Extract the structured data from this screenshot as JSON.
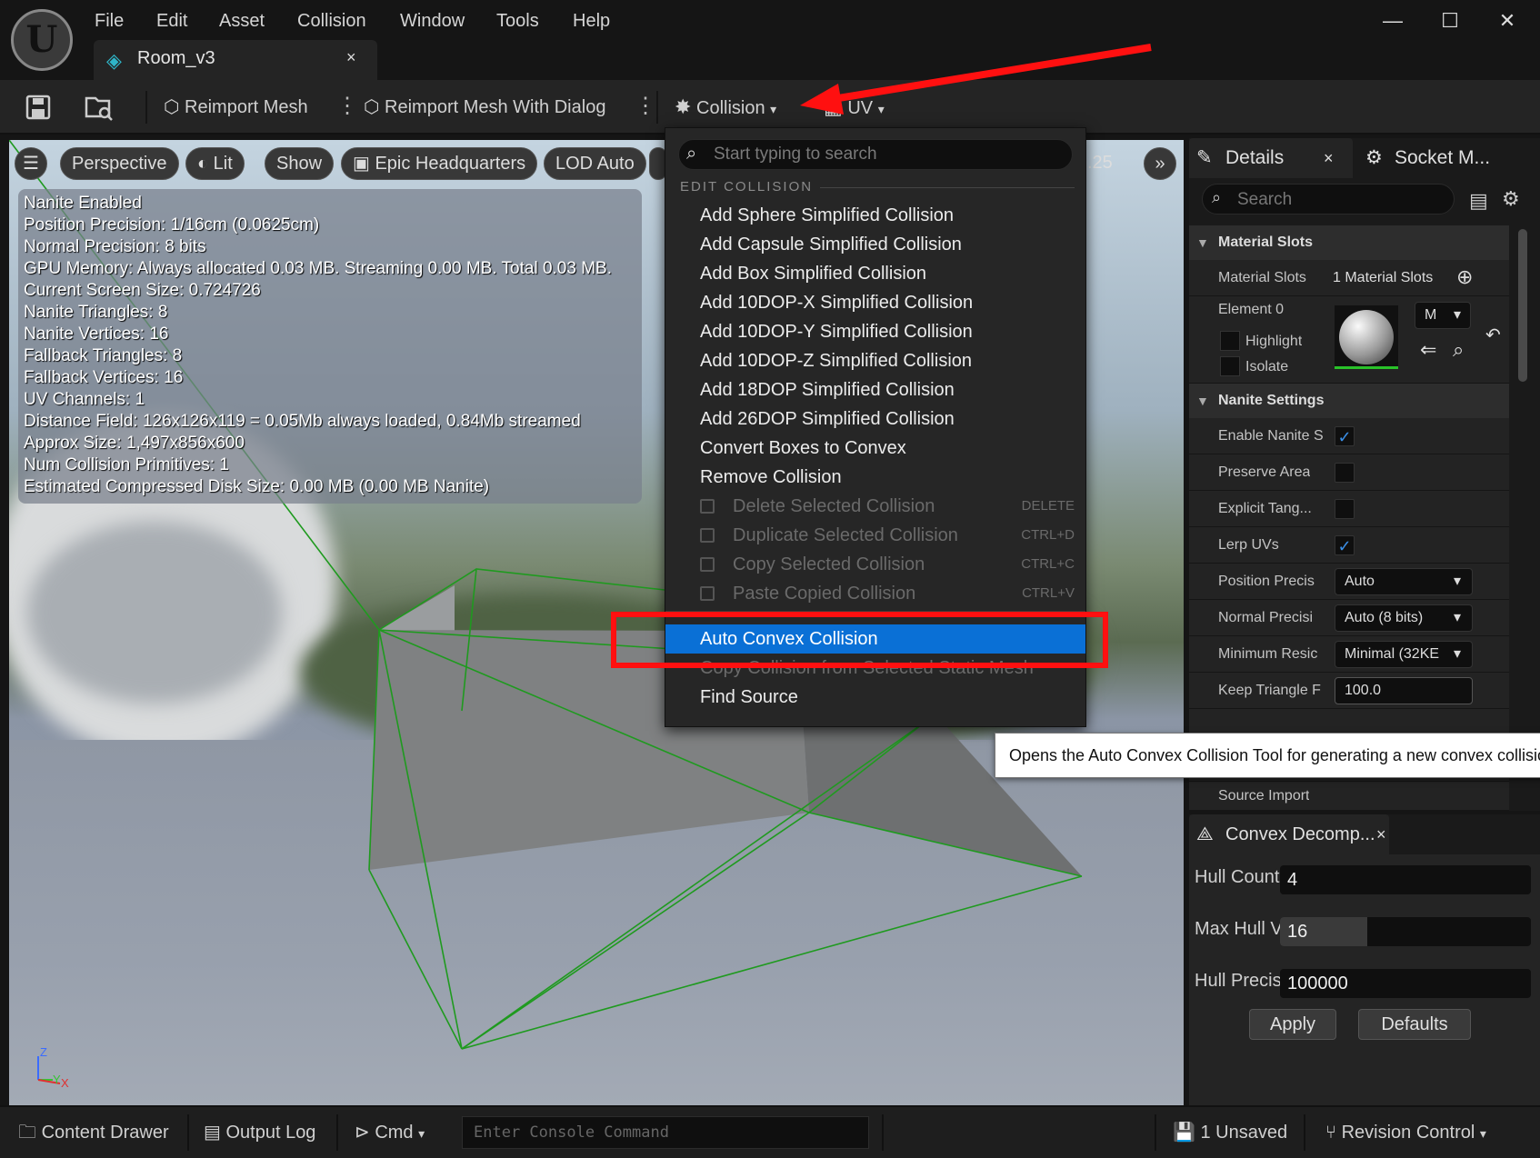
{
  "menubar": {
    "items": [
      "File",
      "Edit",
      "Asset",
      "Collision",
      "Window",
      "Tools",
      "Help"
    ]
  },
  "window_controls": {
    "minimize": "—",
    "maximize": "☐",
    "close": "✕"
  },
  "document_tab": {
    "label": "Room_v3",
    "close": "×"
  },
  "toolbar": {
    "reimport_mesh": "Reimport Mesh",
    "reimport_mesh_dialog": "Reimport Mesh With Dialog",
    "collision": "Collision",
    "uv": "UV"
  },
  "viewport": {
    "toolbar": {
      "perspective": "Perspective",
      "lit": "Lit",
      "show": "Show",
      "headquarters": "Epic Headquarters",
      "lod": "LOD Auto",
      "speed": ".25"
    },
    "info_lines": [
      "Nanite Enabled",
      "Position Precision: 1/16cm (0.0625cm)",
      "Normal Precision: 8 bits",
      "GPU Memory: Always allocated 0.03 MB. Streaming 0.00 MB. Total 0.03 MB.",
      "Current Screen Size:  0.724726",
      "Nanite Triangles:  8",
      "Nanite Vertices:  16",
      "Fallback Triangles:  8",
      "Fallback Vertices:  16",
      "UV Channels:  1",
      "Distance Field:  126x126x119 = 0.05Mb always loaded, 0.84Mb streamed",
      "Approx Size: 1,497x856x600",
      "Num Collision Primitives:  1",
      "Estimated Compressed Disk Size: 0.00 MB (0.00 MB Nanite)"
    ],
    "axis": {
      "z": "Z",
      "y": "Y",
      "x": "X"
    },
    "colors": {
      "wireframe": "#1f9a1f"
    }
  },
  "collision_menu": {
    "search_placeholder": "Start typing to search",
    "section": "EDIT COLLISION",
    "items": [
      {
        "label": "Add Sphere Simplified Collision"
      },
      {
        "label": "Add Capsule Simplified Collision"
      },
      {
        "label": "Add Box Simplified Collision"
      },
      {
        "label": "Add 10DOP-X Simplified Collision"
      },
      {
        "label": "Add 10DOP-Y Simplified Collision"
      },
      {
        "label": "Add 10DOP-Z Simplified Collision"
      },
      {
        "label": "Add 18DOP Simplified Collision"
      },
      {
        "label": "Add 26DOP Simplified Collision"
      },
      {
        "label": "Convert Boxes to Convex"
      },
      {
        "label": "Remove Collision"
      }
    ],
    "disabled_items": [
      {
        "label": "Delete Selected Collision",
        "shortcut": "DELETE"
      },
      {
        "label": "Duplicate Selected Collision",
        "shortcut": "CTRL+D"
      },
      {
        "label": "Copy Selected Collision",
        "shortcut": "CTRL+C"
      },
      {
        "label": "Paste Copied Collision",
        "shortcut": "CTRL+V"
      }
    ],
    "selected_item": "Auto Convex Collision",
    "copy_item": "Copy Collision from Selected Static Mesh",
    "find_source": "Find Source"
  },
  "tooltip": "Opens the Auto Convex Collision Tool for generating a new convex collisio",
  "details": {
    "tab": "Details",
    "tab2": "Socket M...",
    "search_placeholder": "Search",
    "material_slots_header": "Material Slots",
    "material_slots_label": "Material Slots",
    "material_slots_value": "1 Material Slots",
    "element0": "Element 0",
    "highlight": "Highlight",
    "isolate": "Isolate",
    "mat_combo": "M",
    "nanite_header": "Nanite Settings",
    "rows": [
      {
        "label": "Enable Nanite S",
        "type": "check",
        "checked": true
      },
      {
        "label": "Preserve Area",
        "type": "check",
        "checked": false
      },
      {
        "label": "Explicit Tang...",
        "type": "check",
        "checked": false
      },
      {
        "label": "Lerp UVs",
        "type": "check",
        "checked": true
      },
      {
        "label": "Position Precis",
        "type": "combo",
        "value": "Auto"
      },
      {
        "label": "Normal Precisi",
        "type": "combo",
        "value": "Auto (8 bits)"
      },
      {
        "label": "Minimum Resic",
        "type": "combo",
        "value": "Minimal (32KE"
      },
      {
        "label": "Keep Triangle F",
        "type": "number",
        "value": "100.0"
      }
    ],
    "source_import": "Source Import"
  },
  "convex": {
    "tab": "Convex Decomp...",
    "close": "×",
    "hull_count_label": "Hull Count",
    "hull_count": "4",
    "max_hull_label": "Max Hull V",
    "max_hull": "16",
    "hull_precision_label": "Hull Precis",
    "hull_precision": "100000",
    "apply": "Apply",
    "defaults": "Defaults"
  },
  "statusbar": {
    "content_drawer": "Content Drawer",
    "output_log": "Output Log",
    "cmd": "Cmd",
    "console_placeholder": "Enter Console Command",
    "unsaved": "1 Unsaved",
    "revision": "Revision Control"
  }
}
